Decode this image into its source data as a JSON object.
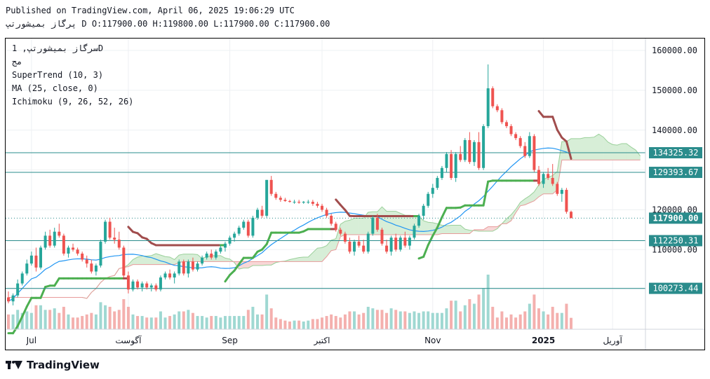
{
  "header": {
    "published": "Published on TradingView.com, April 06, 2025 19:06:29 UTC",
    "ohlc": "پرگاز بمیشورتپ D O:117900.00 H:119800.00 L:117900.00 C:117900.00"
  },
  "legend": {
    "symbol": "سرگاز بمیشورتپ, 1D",
    "exchange": "مج",
    "indicators": [
      "SuperTrend (10, 3)",
      "MA (25, close, 0)",
      "Ichimoku (9, 26, 52, 26)"
    ]
  },
  "footer": {
    "brand": "TradingView"
  },
  "colors": {
    "up": "#26a69a",
    "down": "#ef5350",
    "supertrend_up": "#4caf50",
    "supertrend_down": "#a14d4d",
    "ma": "#2196f3",
    "cloud_red": "#f8d7d7",
    "cloud_green": "#d7eed7",
    "level": "#2a8c8c"
  },
  "chart_data": {
    "type": "candlestick",
    "y_ticks": [
      100000,
      110000,
      120000,
      130000,
      140000,
      150000,
      160000
    ],
    "y_tick_labels": [
      "",
      "110000.00",
      "120000.00",
      "",
      "140000.00",
      "150000.00",
      "160000.00"
    ],
    "ylim": [
      90000,
      163000
    ],
    "x_labels": [
      {
        "label": "Jul",
        "idx": 5
      },
      {
        "label": "آگوست",
        "idx": 26
      },
      {
        "label": "Sep",
        "idx": 48
      },
      {
        "label": "اکتبر",
        "idx": 68
      },
      {
        "label": "Nov",
        "idx": 92
      },
      {
        "label": "2025",
        "idx": 116
      },
      {
        "label": "آوریل",
        "idx": 131
      }
    ],
    "levels": [
      134325.32,
      129393.67,
      112250.31,
      100273.44
    ],
    "level_labels": [
      "134325.32",
      "129393.67",
      "112250.31",
      "100273.44"
    ],
    "last_price": 117900,
    "last_price_label": "117900.00",
    "candles": [
      [
        98000,
        99500,
        96500,
        97000
      ],
      [
        97000,
        99000,
        96000,
        98500
      ],
      [
        98500,
        102500,
        98000,
        101500
      ],
      [
        101500,
        104500,
        101000,
        104000
      ],
      [
        104000,
        107500,
        103500,
        106500
      ],
      [
        106500,
        109500,
        106000,
        108500
      ],
      [
        108500,
        110500,
        104500,
        105500
      ],
      [
        105500,
        111000,
        105000,
        110500
      ],
      [
        110500,
        114500,
        110000,
        113500
      ],
      [
        113500,
        115000,
        110500,
        111000
      ],
      [
        111000,
        115500,
        110500,
        114500
      ],
      [
        114500,
        116500,
        113000,
        113500
      ],
      [
        113500,
        114000,
        108500,
        109000
      ],
      [
        109000,
        111000,
        108000,
        110500
      ],
      [
        110500,
        111500,
        109500,
        110000
      ],
      [
        110000,
        110500,
        108500,
        109000
      ],
      [
        109000,
        109500,
        107000,
        107500
      ],
      [
        107500,
        108500,
        105500,
        106500
      ],
      [
        106500,
        107500,
        104000,
        104500
      ],
      [
        104500,
        106500,
        103500,
        106000
      ],
      [
        106000,
        112500,
        105500,
        112000
      ],
      [
        112000,
        117500,
        111500,
        117000
      ],
      [
        117000,
        118000,
        112500,
        113000
      ],
      [
        113000,
        115500,
        111500,
        112500
      ],
      [
        112500,
        114500,
        110000,
        110500
      ],
      [
        110500,
        111000,
        103000,
        103500
      ],
      [
        103500,
        104500,
        99000,
        100000
      ],
      [
        100000,
        102500,
        99500,
        102000
      ],
      [
        102000,
        102500,
        100000,
        100500
      ],
      [
        100500,
        102000,
        99500,
        101500
      ],
      [
        101500,
        102000,
        100000,
        100500
      ],
      [
        100500,
        101500,
        99500,
        101000
      ],
      [
        101000,
        101500,
        99500,
        100000
      ],
      [
        100000,
        103500,
        99500,
        103000
      ],
      [
        103000,
        104500,
        102500,
        104000
      ],
      [
        104000,
        105000,
        102500,
        103000
      ],
      [
        103000,
        104500,
        101500,
        104000
      ],
      [
        104000,
        107500,
        103500,
        107000
      ],
      [
        107000,
        107500,
        103500,
        104000
      ],
      [
        104000,
        107500,
        103000,
        107000
      ],
      [
        107000,
        108000,
        104500,
        105000
      ],
      [
        105000,
        107000,
        104500,
        106500
      ],
      [
        106500,
        108500,
        106000,
        108000
      ],
      [
        108000,
        109500,
        107500,
        109000
      ],
      [
        109000,
        110000,
        107500,
        108000
      ],
      [
        108000,
        110000,
        107500,
        109500
      ],
      [
        109500,
        111000,
        109000,
        110500
      ],
      [
        110500,
        112000,
        109500,
        111500
      ],
      [
        111500,
        113500,
        111000,
        113000
      ],
      [
        113000,
        114500,
        112000,
        114000
      ],
      [
        114000,
        116000,
        113500,
        115500
      ],
      [
        115500,
        117500,
        115000,
        117000
      ],
      [
        117000,
        117500,
        113000,
        113500
      ],
      [
        113500,
        118500,
        113000,
        118000
      ],
      [
        118000,
        120500,
        117500,
        120000
      ],
      [
        120000,
        121000,
        118000,
        118500
      ],
      [
        118500,
        127500,
        118000,
        127500
      ],
      [
        127500,
        128500,
        123500,
        124000
      ],
      [
        124000,
        124500,
        122500,
        123000
      ],
      [
        123000,
        123500,
        122000,
        122500
      ],
      [
        122500,
        123000,
        122000,
        122200
      ],
      [
        122200,
        122500,
        121800,
        122000
      ],
      [
        122000,
        122500,
        121500,
        122000
      ],
      [
        122000,
        122500,
        121500,
        121800
      ],
      [
        121800,
        122200,
        121500,
        122000
      ],
      [
        122000,
        122500,
        121500,
        122000
      ],
      [
        122000,
        122500,
        121000,
        121500
      ],
      [
        121500,
        122000,
        120500,
        121000
      ],
      [
        121000,
        121500,
        119500,
        120000
      ],
      [
        120000,
        120500,
        118000,
        118500
      ],
      [
        118500,
        119000,
        116000,
        116500
      ],
      [
        116500,
        117000,
        114500,
        115000
      ],
      [
        115000,
        115500,
        113500,
        114000
      ],
      [
        114000,
        114500,
        111500,
        112000
      ],
      [
        112000,
        113000,
        109000,
        109500
      ],
      [
        109500,
        112500,
        108500,
        112000
      ],
      [
        112000,
        113500,
        110500,
        111000
      ],
      [
        111000,
        112500,
        109000,
        109500
      ],
      [
        109500,
        114500,
        109000,
        114000
      ],
      [
        114000,
        118500,
        113500,
        118000
      ],
      [
        118000,
        119000,
        114500,
        115000
      ],
      [
        115000,
        115500,
        111000,
        111500
      ],
      [
        111000,
        112500,
        109000,
        109500
      ],
      [
        109500,
        113500,
        108500,
        113000
      ],
      [
        113000,
        114000,
        109500,
        110000
      ],
      [
        110000,
        113500,
        109500,
        113000
      ],
      [
        113000,
        114500,
        110500,
        111000
      ],
      [
        111000,
        113500,
        110000,
        113000
      ],
      [
        113000,
        116500,
        112500,
        116000
      ],
      [
        116000,
        119000,
        115500,
        118500
      ],
      [
        118500,
        121500,
        117500,
        121000
      ],
      [
        121000,
        124500,
        120500,
        124000
      ],
      [
        124000,
        126500,
        123000,
        125500
      ],
      [
        125500,
        128500,
        125000,
        128000
      ],
      [
        128000,
        131000,
        127500,
        130500
      ],
      [
        130500,
        134500,
        129500,
        134000
      ],
      [
        134000,
        135000,
        127500,
        128000
      ],
      [
        128000,
        134500,
        127000,
        134000
      ],
      [
        134000,
        136000,
        132000,
        132500
      ],
      [
        132500,
        138000,
        132000,
        137500
      ],
      [
        137500,
        139500,
        131500,
        132000
      ],
      [
        132000,
        137500,
        131000,
        137000
      ],
      [
        137000,
        139500,
        130000,
        130500
      ],
      [
        130500,
        141500,
        130000,
        141000
      ],
      [
        141000,
        156500,
        140500,
        150500
      ],
      [
        150500,
        151000,
        145500,
        146000
      ],
      [
        146000,
        146500,
        144500,
        145000
      ],
      [
        145000,
        145500,
        141500,
        142000
      ],
      [
        142000,
        142500,
        140500,
        141000
      ],
      [
        141000,
        141500,
        138500,
        139000
      ],
      [
        139000,
        139500,
        137500,
        138000
      ],
      [
        138000,
        138500,
        135500,
        136000
      ],
      [
        136000,
        137000,
        133000,
        133500
      ],
      [
        133500,
        139500,
        133000,
        138500
      ],
      [
        138500,
        139000,
        129500,
        130000
      ],
      [
        130000,
        131000,
        126000,
        126500
      ],
      [
        126500,
        129500,
        125500,
        129000
      ],
      [
        129000,
        130500,
        127500,
        128000
      ],
      [
        128000,
        131500,
        126000,
        126500
      ],
      [
        126500,
        127000,
        123500,
        124000
      ],
      [
        124000,
        125500,
        122000,
        125000
      ],
      [
        125000,
        125500,
        119000,
        119500
      ],
      [
        119500,
        119800,
        117900,
        117900
      ]
    ]
  }
}
